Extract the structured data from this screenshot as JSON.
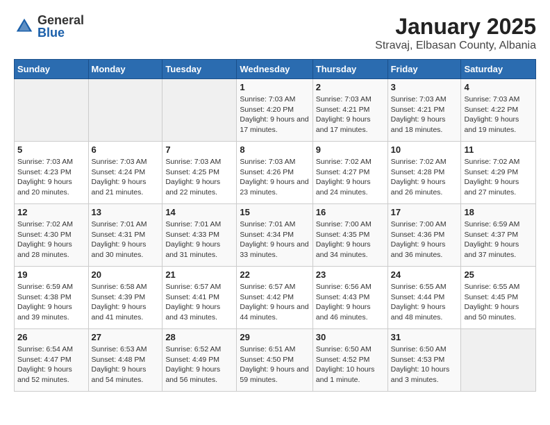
{
  "header": {
    "logo_general": "General",
    "logo_blue": "Blue",
    "title": "January 2025",
    "subtitle": "Stravaj, Elbasan County, Albania"
  },
  "weekdays": [
    "Sunday",
    "Monday",
    "Tuesday",
    "Wednesday",
    "Thursday",
    "Friday",
    "Saturday"
  ],
  "weeks": [
    [
      {
        "day": "",
        "info": ""
      },
      {
        "day": "",
        "info": ""
      },
      {
        "day": "",
        "info": ""
      },
      {
        "day": "1",
        "info": "Sunrise: 7:03 AM\nSunset: 4:20 PM\nDaylight: 9 hours and 17 minutes."
      },
      {
        "day": "2",
        "info": "Sunrise: 7:03 AM\nSunset: 4:21 PM\nDaylight: 9 hours and 17 minutes."
      },
      {
        "day": "3",
        "info": "Sunrise: 7:03 AM\nSunset: 4:21 PM\nDaylight: 9 hours and 18 minutes."
      },
      {
        "day": "4",
        "info": "Sunrise: 7:03 AM\nSunset: 4:22 PM\nDaylight: 9 hours and 19 minutes."
      }
    ],
    [
      {
        "day": "5",
        "info": "Sunrise: 7:03 AM\nSunset: 4:23 PM\nDaylight: 9 hours and 20 minutes."
      },
      {
        "day": "6",
        "info": "Sunrise: 7:03 AM\nSunset: 4:24 PM\nDaylight: 9 hours and 21 minutes."
      },
      {
        "day": "7",
        "info": "Sunrise: 7:03 AM\nSunset: 4:25 PM\nDaylight: 9 hours and 22 minutes."
      },
      {
        "day": "8",
        "info": "Sunrise: 7:03 AM\nSunset: 4:26 PM\nDaylight: 9 hours and 23 minutes."
      },
      {
        "day": "9",
        "info": "Sunrise: 7:02 AM\nSunset: 4:27 PM\nDaylight: 9 hours and 24 minutes."
      },
      {
        "day": "10",
        "info": "Sunrise: 7:02 AM\nSunset: 4:28 PM\nDaylight: 9 hours and 26 minutes."
      },
      {
        "day": "11",
        "info": "Sunrise: 7:02 AM\nSunset: 4:29 PM\nDaylight: 9 hours and 27 minutes."
      }
    ],
    [
      {
        "day": "12",
        "info": "Sunrise: 7:02 AM\nSunset: 4:30 PM\nDaylight: 9 hours and 28 minutes."
      },
      {
        "day": "13",
        "info": "Sunrise: 7:01 AM\nSunset: 4:31 PM\nDaylight: 9 hours and 30 minutes."
      },
      {
        "day": "14",
        "info": "Sunrise: 7:01 AM\nSunset: 4:33 PM\nDaylight: 9 hours and 31 minutes."
      },
      {
        "day": "15",
        "info": "Sunrise: 7:01 AM\nSunset: 4:34 PM\nDaylight: 9 hours and 33 minutes."
      },
      {
        "day": "16",
        "info": "Sunrise: 7:00 AM\nSunset: 4:35 PM\nDaylight: 9 hours and 34 minutes."
      },
      {
        "day": "17",
        "info": "Sunrise: 7:00 AM\nSunset: 4:36 PM\nDaylight: 9 hours and 36 minutes."
      },
      {
        "day": "18",
        "info": "Sunrise: 6:59 AM\nSunset: 4:37 PM\nDaylight: 9 hours and 37 minutes."
      }
    ],
    [
      {
        "day": "19",
        "info": "Sunrise: 6:59 AM\nSunset: 4:38 PM\nDaylight: 9 hours and 39 minutes."
      },
      {
        "day": "20",
        "info": "Sunrise: 6:58 AM\nSunset: 4:39 PM\nDaylight: 9 hours and 41 minutes."
      },
      {
        "day": "21",
        "info": "Sunrise: 6:57 AM\nSunset: 4:41 PM\nDaylight: 9 hours and 43 minutes."
      },
      {
        "day": "22",
        "info": "Sunrise: 6:57 AM\nSunset: 4:42 PM\nDaylight: 9 hours and 44 minutes."
      },
      {
        "day": "23",
        "info": "Sunrise: 6:56 AM\nSunset: 4:43 PM\nDaylight: 9 hours and 46 minutes."
      },
      {
        "day": "24",
        "info": "Sunrise: 6:55 AM\nSunset: 4:44 PM\nDaylight: 9 hours and 48 minutes."
      },
      {
        "day": "25",
        "info": "Sunrise: 6:55 AM\nSunset: 4:45 PM\nDaylight: 9 hours and 50 minutes."
      }
    ],
    [
      {
        "day": "26",
        "info": "Sunrise: 6:54 AM\nSunset: 4:47 PM\nDaylight: 9 hours and 52 minutes."
      },
      {
        "day": "27",
        "info": "Sunrise: 6:53 AM\nSunset: 4:48 PM\nDaylight: 9 hours and 54 minutes."
      },
      {
        "day": "28",
        "info": "Sunrise: 6:52 AM\nSunset: 4:49 PM\nDaylight: 9 hours and 56 minutes."
      },
      {
        "day": "29",
        "info": "Sunrise: 6:51 AM\nSunset: 4:50 PM\nDaylight: 9 hours and 59 minutes."
      },
      {
        "day": "30",
        "info": "Sunrise: 6:50 AM\nSunset: 4:52 PM\nDaylight: 10 hours and 1 minute."
      },
      {
        "day": "31",
        "info": "Sunrise: 6:50 AM\nSunset: 4:53 PM\nDaylight: 10 hours and 3 minutes."
      },
      {
        "day": "",
        "info": ""
      }
    ]
  ]
}
